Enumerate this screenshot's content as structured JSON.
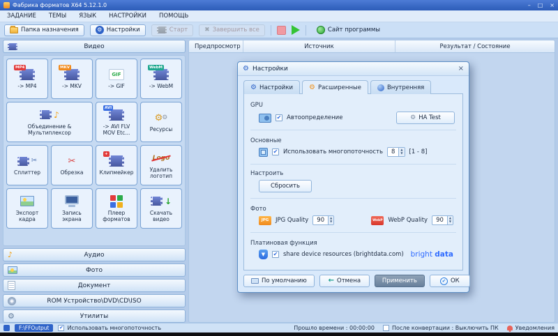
{
  "colors": {
    "titlebar": "#2f63c5",
    "accent": "#2e63c8",
    "stop_red": "#f09aa2",
    "start_green": "#35c435",
    "apply_button": "#68809c",
    "brand_blue": "#2f6bff"
  },
  "titlebar": {
    "title": "Фабрика форматов X64 5.12.1.0",
    "minimize": "–",
    "maximize": "□",
    "close": "×"
  },
  "menubar": {
    "items": [
      "ЗАДАНИЕ",
      "ТЕМЫ",
      "ЯЗЫК",
      "НАСТРОЙКИ",
      "ПОМОЩЬ"
    ]
  },
  "toolbar": {
    "dest_folder": "Папка назначения",
    "settings": "Настройки",
    "start_label": "Старт",
    "finish_label": "Завершить все",
    "site": "Сайт программы"
  },
  "content": {
    "columns": [
      "Предпросмотр",
      "Источник",
      "Результат / Состояние"
    ]
  },
  "sidebar": {
    "sections": [
      "Видео",
      "Аудио",
      "Фото",
      "Документ",
      "ROM Устройство\\DVD\\CD\\ISO",
      "Утилиты"
    ],
    "tools": [
      "-> MP4",
      "-> MKV",
      "-> GIF",
      "-> WebM",
      "Объединение & Мультиплексор",
      "-> AVI FLV MOV Etc...",
      "Ресурсы",
      "Сплиттер",
      "Обрезка",
      "Клипмейкер",
      "Удалить логотип",
      "Экспорт кадра",
      "Запись экрана",
      "Плеер форматов",
      "Скачать видео"
    ]
  },
  "dialog": {
    "title": "Настройки",
    "close": "×",
    "tabs": [
      "Настройки",
      "Расширенные",
      "Внутренняя"
    ],
    "gpu": {
      "label": "GPU",
      "autodetect": "Автоопределение",
      "ha_test": "HA Test"
    },
    "basic": {
      "label": "Основные",
      "multithread": "Использовать многопоточность",
      "threads": "8",
      "range": "[1 - 8]"
    },
    "custom": {
      "label": "Настроить",
      "reset": "Сбросить"
    },
    "photo": {
      "label": "Фото",
      "jpg_label": "JPG Quality",
      "jpg_value": "90",
      "webp_label": "WebP Quality",
      "webp_value": "90"
    },
    "platinum": {
      "label": "Платиновая функция",
      "share": "share device resources (brightdata.com)",
      "brand_a": "bright ",
      "brand_b": "data"
    },
    "buttons": {
      "default": "По умолчанию",
      "cancel": "Отмена",
      "apply": "Применить",
      "ok": "ОК"
    }
  },
  "statusbar": {
    "output": "F:\\FFOutput",
    "multithread": "Использовать многопоточность",
    "elapsed": "Прошло времени : 00:00:00",
    "shutdown": "После конвертации : Выключить ПК",
    "notifications": "Уведомления"
  },
  "icons": {
    "gear": "⚙",
    "scissors": "✂",
    "note": "♪",
    "down_arrow": "↓",
    "back_arrow": "←",
    "check": "✔",
    "cross": "✖",
    "spin_up": "▲",
    "spin_down": "▼",
    "badge_mp4": "MP4",
    "badge_mkv": "MKV",
    "badge_gif": "GIF",
    "badge_webm": "WebM",
    "badge_avi": "AVI",
    "badge_plus": "+",
    "logo_text": "Logo",
    "jpg_text": "JPG",
    "webp_text": "WebP",
    "shield_mark": "▼"
  }
}
